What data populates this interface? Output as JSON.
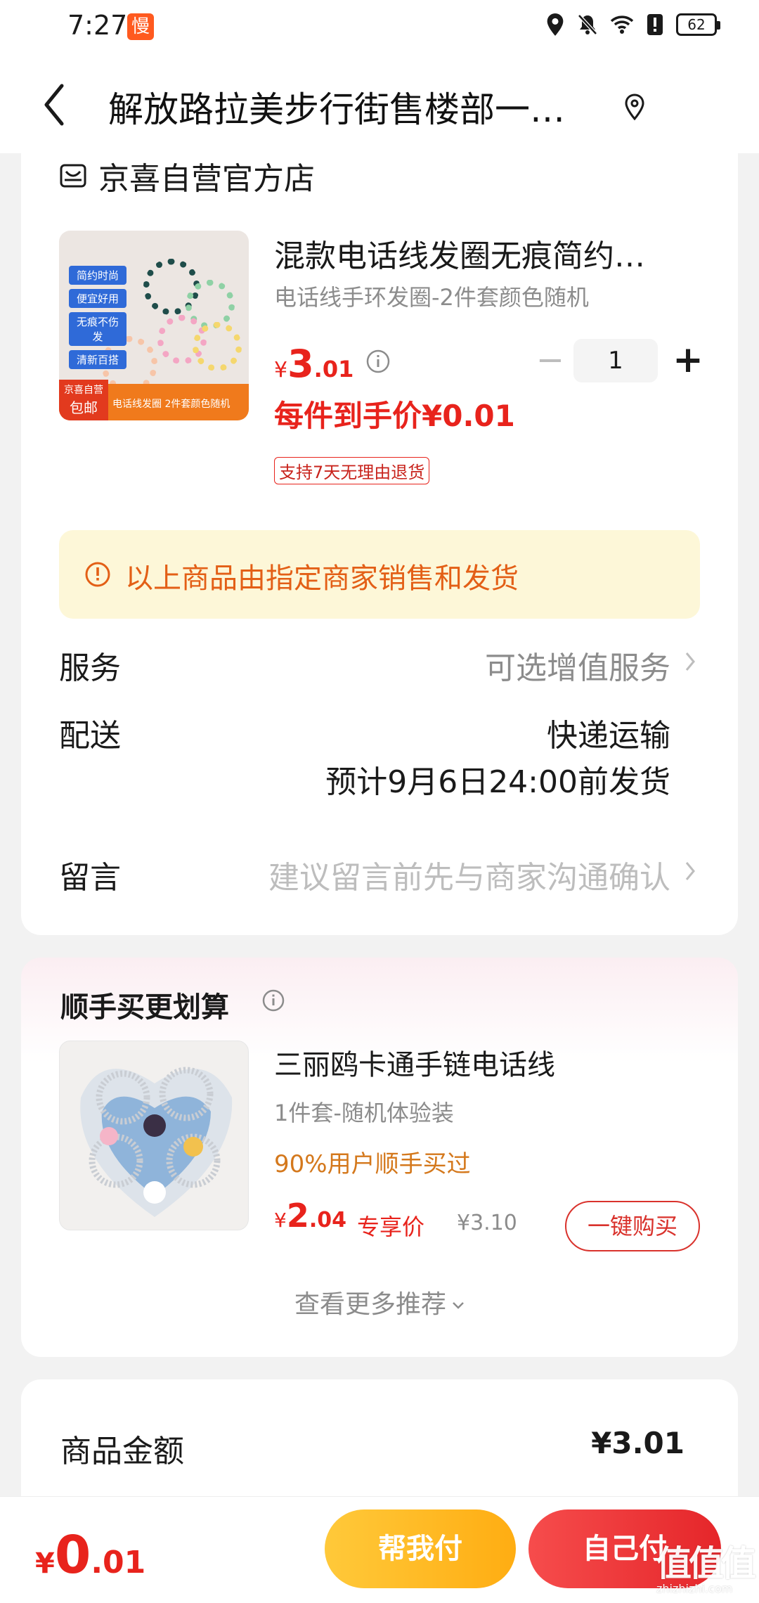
{
  "status_bar": {
    "time": "7:27",
    "app_badge": "慢",
    "battery": "62",
    "icons": [
      "location-icon",
      "mute-icon",
      "wifi-icon",
      "alert-icon",
      "battery-icon"
    ]
  },
  "header": {
    "title": "解放路拉美步行街售楼部一…",
    "back_icon": "chevron-left-icon",
    "location_icon": "location-pin-icon"
  },
  "store": {
    "name": "京喜自营官方店",
    "product": {
      "title": "混款电话线发圈无痕简约…",
      "spec": "电话线手环发圈-2件套颜色随机",
      "price": {
        "yen": "¥",
        "int": "3",
        "dec": ".01"
      },
      "quantity": "1",
      "final_price": "每件到手价¥0.01",
      "return_badge": "支持7天无理由退货",
      "image_tags": [
        "简约时尚",
        "便宜好用",
        "无痕不伤发",
        "清新百搭"
      ],
      "image_badge_top": "京喜自营",
      "image_badge_bottom": "包邮",
      "image_caption": "电话线发圈 2件套颜色随机"
    },
    "notice": "以上商品由指定商家销售和发货",
    "service": {
      "label": "服务",
      "value": "可选增值服务"
    },
    "delivery": {
      "label": "配送",
      "method": "快递运输",
      "eta": "预计9月6日24:00前发货"
    },
    "message": {
      "label": "留言",
      "placeholder": "建议留言前先与商家沟通确认"
    }
  },
  "recommend": {
    "title": "顺手买更划算",
    "item": {
      "name": "三丽鸥卡通手链电话线",
      "spec": "1件套-随机体验装",
      "social_proof": "90%用户顺手买过",
      "price": {
        "yen": "¥",
        "int": "2",
        "dec": ".04"
      },
      "exclusive_label": "专享价",
      "original_price": "¥3.10",
      "buy_label": "一键购买"
    },
    "more_label": "查看更多推荐"
  },
  "summary": {
    "goods_amount_label": "商品金额",
    "goods_amount_value": "¥3.01"
  },
  "bottom": {
    "total": {
      "yen": "¥",
      "int": "0",
      "dec": ".01"
    },
    "help_pay_label": "帮我付",
    "self_pay_label": "自己付"
  },
  "watermark": {
    "logo": "值值值",
    "site": "zhizhizhi.com"
  },
  "colors": {
    "price_red": "#e8231c",
    "notice_bg": "#fdf7d8",
    "notice_text": "#e35f16",
    "help_btn": "#ffb51f",
    "self_btn": "#ee3436"
  }
}
